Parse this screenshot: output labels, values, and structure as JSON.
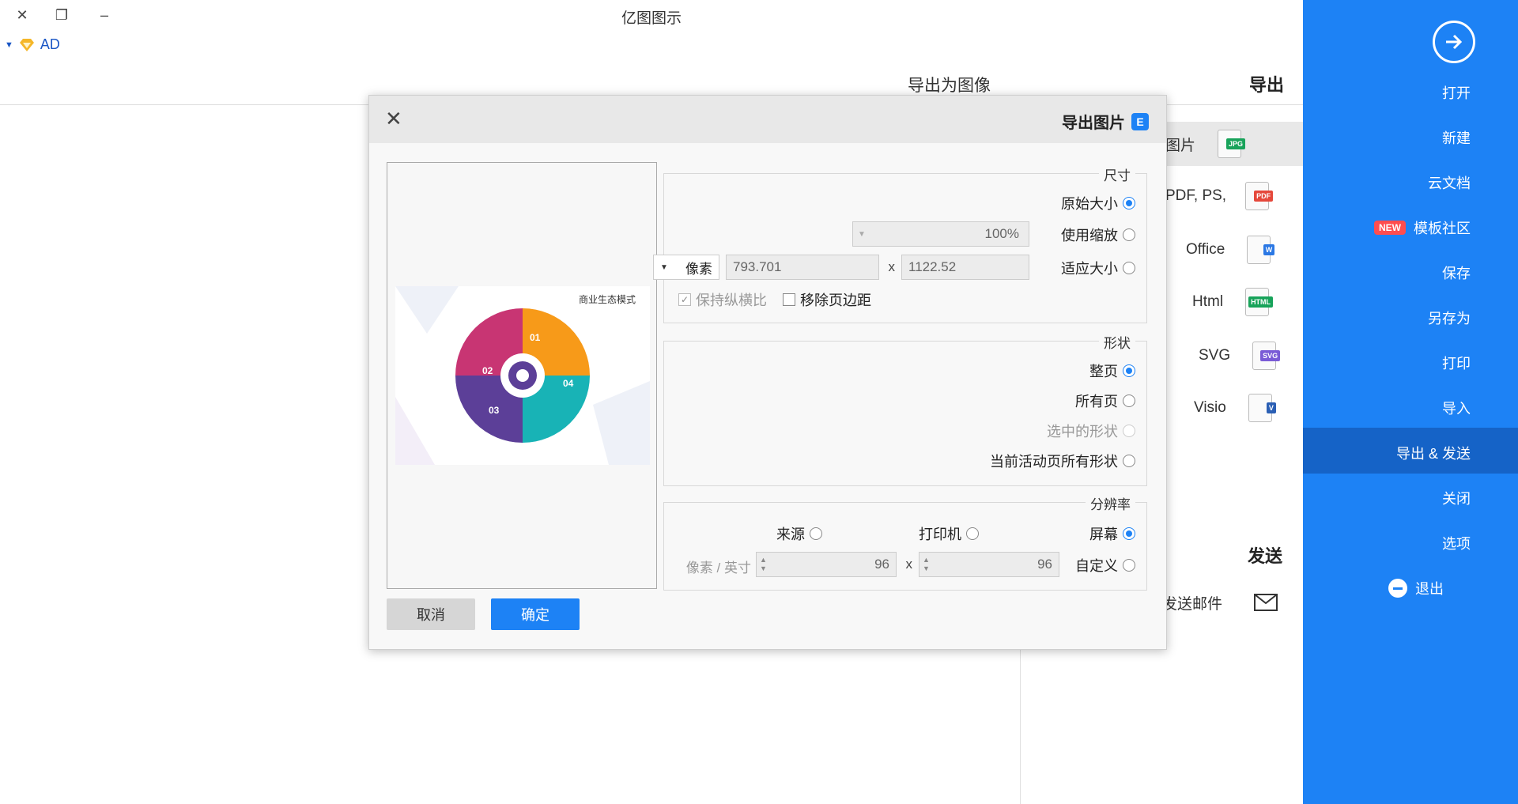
{
  "titlebar": {
    "app_title": "亿图图示",
    "user_label": "AD"
  },
  "sidebar": {
    "items": [
      {
        "label": "打开"
      },
      {
        "label": "新建"
      },
      {
        "label": "云文档"
      },
      {
        "label": "模板社区",
        "badge": "NEW"
      },
      {
        "label": "保存"
      },
      {
        "label": "另存为"
      },
      {
        "label": "打印"
      },
      {
        "label": "导入"
      },
      {
        "label": "导出 & 发送"
      },
      {
        "label": "关闭"
      },
      {
        "label": "选项"
      },
      {
        "label": "退出"
      }
    ],
    "active_index": 8
  },
  "export_panel": {
    "heading": "导出",
    "title": "导出为图像",
    "items": [
      {
        "label": "图片",
        "tag": "JPG",
        "tag_color": "#18a35a"
      },
      {
        "label": "PDF, PS,",
        "tag": "PDF",
        "tag_color": "#e5483b"
      },
      {
        "label": "Office",
        "tag": "W",
        "tag_color": "#2b78e4"
      },
      {
        "label": "Html",
        "tag": "HTML",
        "tag_color": "#18a35a"
      },
      {
        "label": "SVG",
        "tag": "SVG",
        "tag_color": "#7a5bd6"
      },
      {
        "label": "Visio",
        "tag": "V",
        "tag_color": "#2b5fb4"
      }
    ],
    "send_heading": "发送",
    "send_email_label": "发送邮件"
  },
  "dialog": {
    "title": "导出图片",
    "size_group": {
      "title": "尺寸",
      "original_size": "原始大小",
      "use_zoom": "使用缩放",
      "zoom_value": "100%",
      "fit_size": "适应大小",
      "width_value": "1122.52",
      "x_sep": "x",
      "height_value": "793.701",
      "unit": "像素",
      "remove_margin": "移除页边距",
      "keep_ratio": "保持纵横比"
    },
    "shape_group": {
      "title": "形状",
      "whole_page": "整页",
      "all_pages": "所有页",
      "selected_shapes": "选中的形状",
      "current_page_shapes": "当前活动页所有形状"
    },
    "resolution_group": {
      "title": "分辨率",
      "screen": "屏幕",
      "printer": "打印机",
      "source": "来源",
      "custom": "自定义",
      "dpi_x": "96",
      "x_sep": "x",
      "dpi_y": "96",
      "unit": "像素 / 英寸"
    },
    "preview_title": "商业生态模式",
    "preview_labels": [
      "01",
      "02",
      "03",
      "04"
    ],
    "ok_label": "确定",
    "cancel_label": "取消"
  }
}
